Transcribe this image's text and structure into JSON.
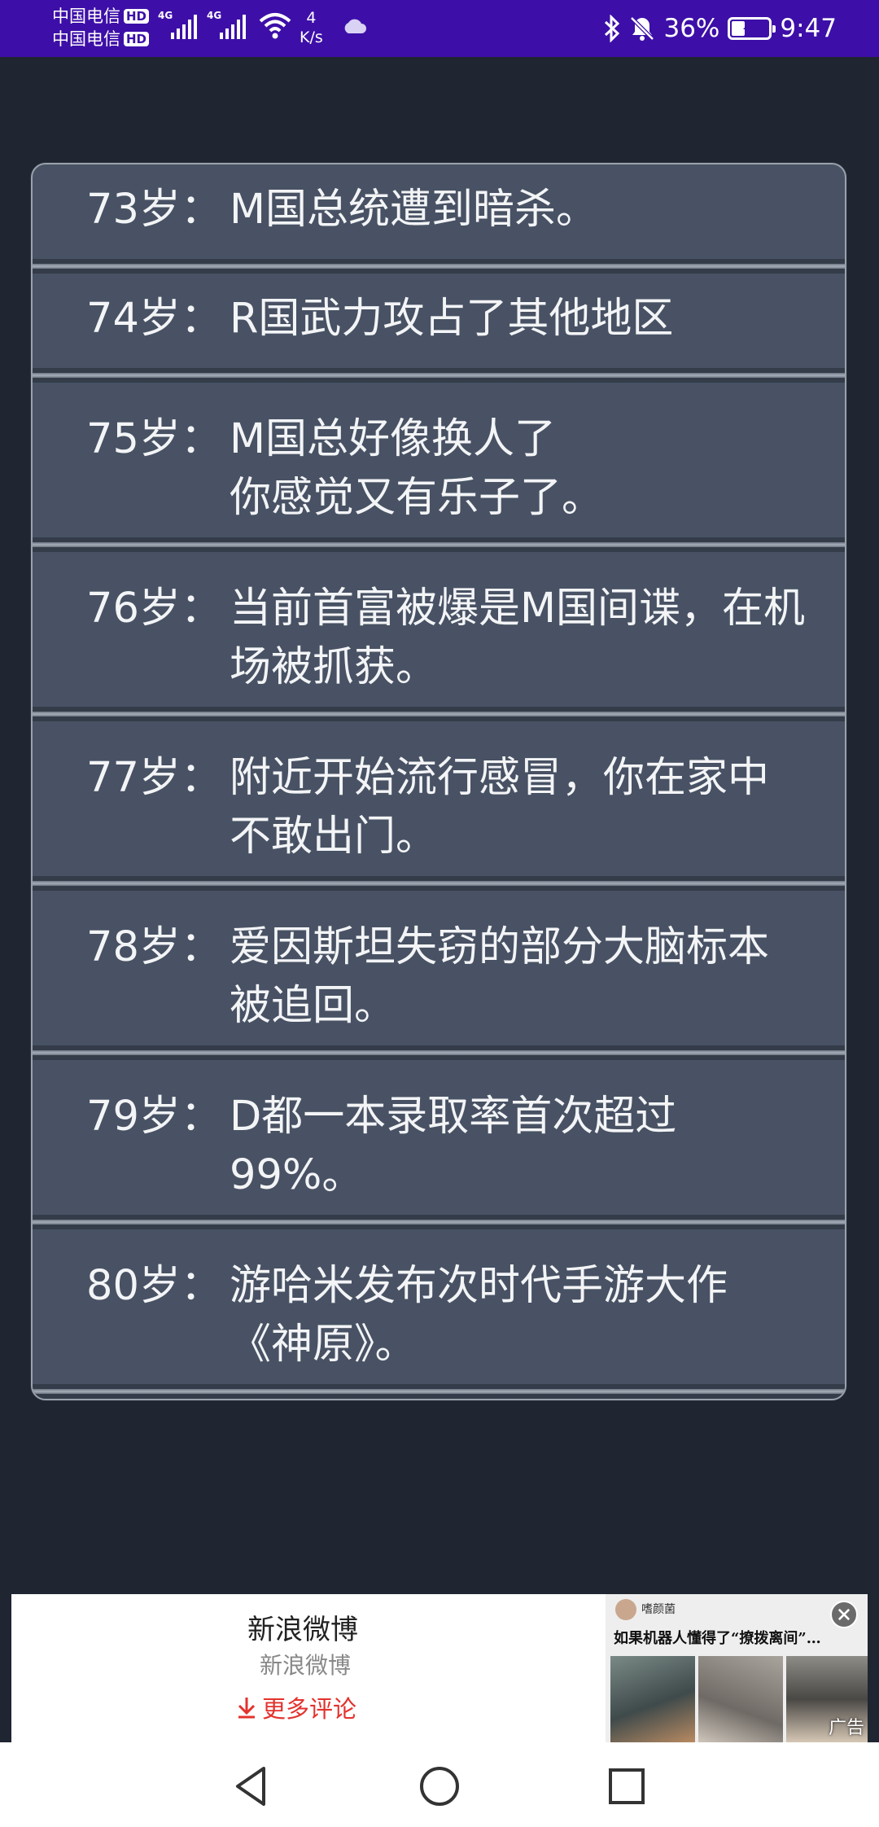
{
  "status_bar": {
    "carrier_1": "中国电信",
    "carrier_2": "中国电信",
    "hd_badge": "HD",
    "network_1": "4G",
    "network_2": "4G",
    "net_speed_value": "4",
    "net_speed_unit": "K/s",
    "battery_percent": "36%",
    "battery_level": 0.36,
    "time": "9:47"
  },
  "timeline": [
    {
      "age": "73岁：",
      "event": "M国总统遭到暗杀。"
    },
    {
      "age": "74岁：",
      "event": "R国武力攻占了其他地区"
    },
    {
      "age": "75岁：",
      "event": "M国总好像换人了\n你感觉又有乐子了。"
    },
    {
      "age": "76岁：",
      "event": "当前首富被爆是M国间谍，在机场被抓获。"
    },
    {
      "age": "77岁：",
      "event": "附近开始流行感冒，你在家中不敢出门。"
    },
    {
      "age": "78岁：",
      "event": "爱因斯坦失窃的部分大脑标本被追回。"
    },
    {
      "age": "79岁：",
      "event": "D都一本录取率首次超过99%。"
    },
    {
      "age": "80岁：",
      "event": "游哈米发布次时代手游大作《神原》。"
    }
  ],
  "ad": {
    "title": "新浪微博",
    "subtitle": "新浪微博",
    "more_comments": "更多评论",
    "author": "嗜颜菌",
    "headline": "如果机器人懂得了“撩拨离间”…",
    "label": "广告"
  },
  "colors": {
    "status_bar": "#3d0fa8",
    "background": "#1f2531",
    "card": "#485264",
    "accent_red": "#e3322d"
  }
}
